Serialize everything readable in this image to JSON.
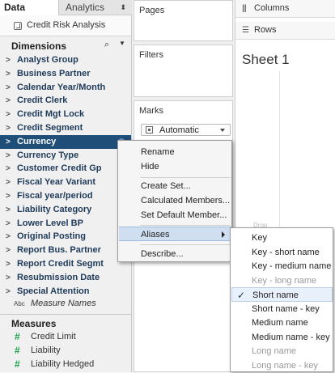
{
  "tabs": {
    "data_label": "Data",
    "analytics_label": "Analytics",
    "analytics_caret": "⬍"
  },
  "datasource": {
    "name": "Credit Risk Analysis"
  },
  "dimensions": {
    "title": "Dimensions",
    "search_icon": "⌕",
    "menu_icon": "▼",
    "items": [
      {
        "label": "Analyst Group"
      },
      {
        "label": "Business Partner"
      },
      {
        "label": "Calendar Year/Month"
      },
      {
        "label": "Credit Clerk"
      },
      {
        "label": "Credit Mgt Lock"
      },
      {
        "label": "Credit Segment"
      },
      {
        "label": "Currency"
      },
      {
        "label": "Currency Type"
      },
      {
        "label": "Customer Credit Gp"
      },
      {
        "label": "Fiscal Year Variant"
      },
      {
        "label": "Fiscal year/period"
      },
      {
        "label": "Liability Category"
      },
      {
        "label": "Lower Level BP"
      },
      {
        "label": "Original Posting"
      },
      {
        "label": "Report Bus. Partner"
      },
      {
        "label": "Report Credit Segmt"
      },
      {
        "label": "Resubmission Date"
      },
      {
        "label": "Special Attention"
      }
    ],
    "selected_index": 6,
    "chevron": ">",
    "abc_icon": "Abc",
    "measure_names_label": "Measure Names"
  },
  "measures": {
    "title": "Measures",
    "hash_icon": "#",
    "items": [
      {
        "label": "Credit Limit"
      },
      {
        "label": "Liability"
      },
      {
        "label": "Liability Hedged"
      }
    ]
  },
  "shelves": {
    "pages_label": "Pages",
    "filters_label": "Filters",
    "marks_label": "Marks",
    "marks_type": "Automatic",
    "columns_label": "Columns",
    "rows_label": "Rows",
    "columns_icon": "|||",
    "rows_icon": "☰"
  },
  "sheet": {
    "title": "Sheet 1",
    "ghost_text": "Drop"
  },
  "context_menu": {
    "items": [
      "Rename",
      "Hide",
      "Create Set...",
      "Calculated Members...",
      "Set Default Member...",
      "Aliases",
      "Describe..."
    ],
    "highlighted": "Aliases"
  },
  "aliases_submenu": {
    "items": [
      {
        "label": "Key",
        "enabled": true
      },
      {
        "label": "Key - short name",
        "enabled": true
      },
      {
        "label": "Key - medium name",
        "enabled": true
      },
      {
        "label": "Key - long name",
        "enabled": false
      },
      {
        "label": "Short name",
        "enabled": true,
        "checked": true
      },
      {
        "label": "Short name - key",
        "enabled": true
      },
      {
        "label": "Medium name",
        "enabled": true
      },
      {
        "label": "Medium name - key",
        "enabled": true
      },
      {
        "label": "Long name",
        "enabled": false
      },
      {
        "label": "Long name - key",
        "enabled": false
      }
    ],
    "check_mark": "✓"
  },
  "colors": {
    "selection": "#1f4e79",
    "measure_green": "#1aa24a",
    "menu_highlight": "#cfdff1"
  }
}
